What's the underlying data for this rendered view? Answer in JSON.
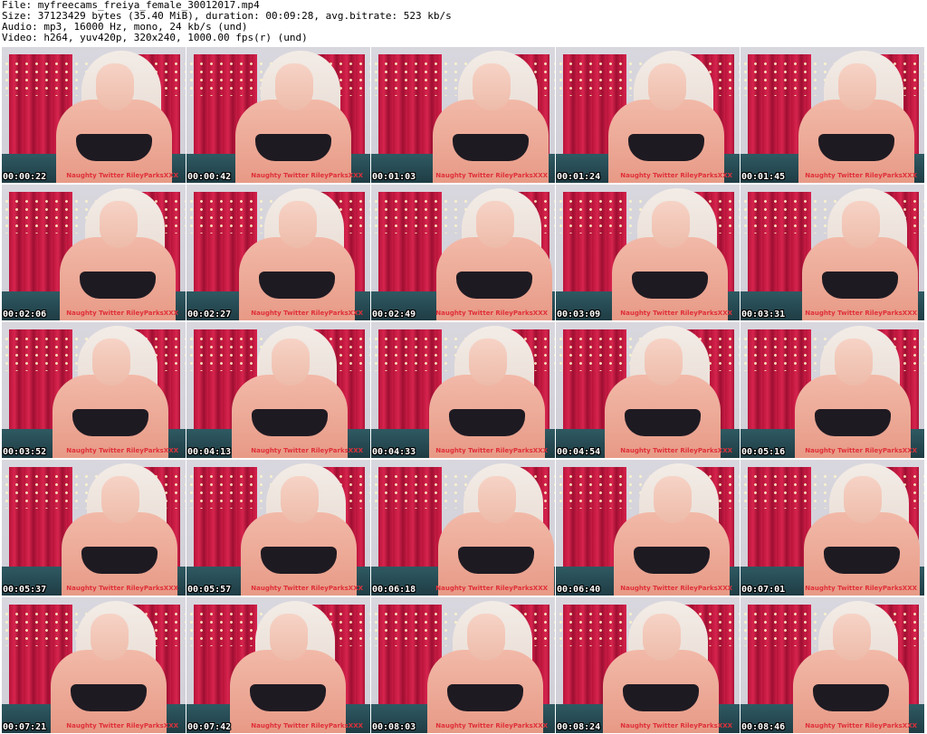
{
  "header": {
    "file": "File: myfreecams_freiya_female_30012017.mp4",
    "size": "Size: 37123429 bytes (35.40 MiB), duration: 00:09:28, avg.bitrate: 523 kb/s",
    "audio": "Audio: mp3, 16000 Hz, mono, 24 kb/s (und)",
    "video": "Video: h264, yuv420p, 320x240, 1000.00 fps(r) (und)"
  },
  "watermark_text": "Naughty Twitter RileyParksXXX",
  "thumbnails": [
    {
      "timestamp": "00:00:22"
    },
    {
      "timestamp": "00:00:42"
    },
    {
      "timestamp": "00:01:03"
    },
    {
      "timestamp": "00:01:24"
    },
    {
      "timestamp": "00:01:45"
    },
    {
      "timestamp": "00:02:06"
    },
    {
      "timestamp": "00:02:27"
    },
    {
      "timestamp": "00:02:49"
    },
    {
      "timestamp": "00:03:09"
    },
    {
      "timestamp": "00:03:31"
    },
    {
      "timestamp": "00:03:52"
    },
    {
      "timestamp": "00:04:13"
    },
    {
      "timestamp": "00:04:33"
    },
    {
      "timestamp": "00:04:54"
    },
    {
      "timestamp": "00:05:16"
    },
    {
      "timestamp": "00:05:37"
    },
    {
      "timestamp": "00:05:57"
    },
    {
      "timestamp": "00:06:18"
    },
    {
      "timestamp": "00:06:40"
    },
    {
      "timestamp": "00:07:01"
    },
    {
      "timestamp": "00:07:21"
    },
    {
      "timestamp": "00:07:42"
    },
    {
      "timestamp": "00:08:03"
    },
    {
      "timestamp": "00:08:24"
    },
    {
      "timestamp": "00:08:46"
    }
  ]
}
